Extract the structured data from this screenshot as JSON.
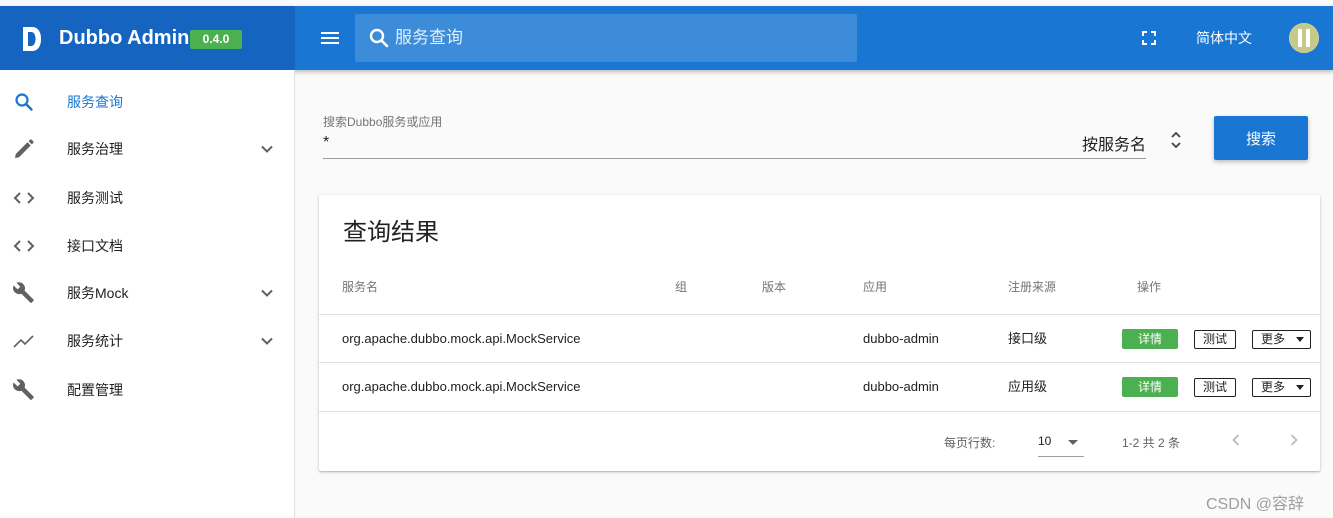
{
  "app": {
    "title": "Dubbo Admin",
    "version": "0.4.0"
  },
  "topbar": {
    "search_placeholder": "服务查询",
    "language": "简体中文"
  },
  "sidebar": {
    "items": [
      {
        "label": "服务查询",
        "icon": "search-icon",
        "active": true
      },
      {
        "label": "服务治理",
        "icon": "pencil-icon",
        "expandable": true
      },
      {
        "label": "服务测试",
        "icon": "code-icon"
      },
      {
        "label": "接口文档",
        "icon": "code-icon"
      },
      {
        "label": "服务Mock",
        "icon": "wrench-icon",
        "expandable": true
      },
      {
        "label": "服务统计",
        "icon": "trending-icon",
        "expandable": true
      },
      {
        "label": "配置管理",
        "icon": "wrench-icon"
      }
    ]
  },
  "search": {
    "label": "搜索Dubbo服务或应用",
    "value": "*",
    "type_selected": "按服务名",
    "button": "搜索"
  },
  "results": {
    "title": "查询结果",
    "columns": [
      "服务名",
      "组",
      "版本",
      "应用",
      "注册来源",
      "操作"
    ],
    "rows": [
      {
        "service": "org.apache.dubbo.mock.api.MockService",
        "group": "",
        "version": "",
        "app": "dubbo-admin",
        "source": "接口级"
      },
      {
        "service": "org.apache.dubbo.mock.api.MockService",
        "group": "",
        "version": "",
        "app": "dubbo-admin",
        "source": "应用级"
      }
    ],
    "actions": {
      "detail": "详情",
      "test": "测试",
      "more": "更多"
    },
    "pagination": {
      "rows_per_page_label": "每页行数:",
      "rows_per_page": "10",
      "range": "1-2 共 2 条"
    }
  },
  "watermark": "CSDN @容辞",
  "colors": {
    "primary": "#1976d2",
    "brand_bg": "#1565c0",
    "success": "#4caf50"
  }
}
